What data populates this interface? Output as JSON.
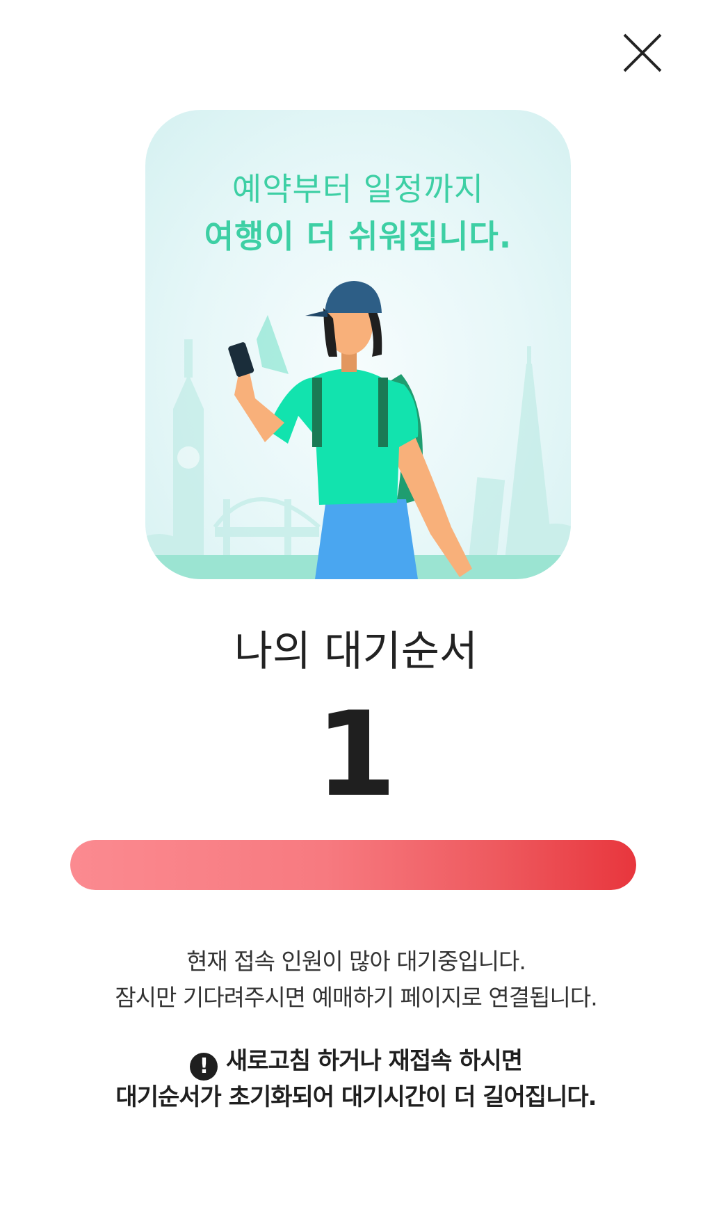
{
  "header": {
    "close_icon": "close-icon"
  },
  "hero": {
    "line1": "예약부터 일정까지",
    "line2": "여행이 더 쉬워집니다.",
    "colors": {
      "headline": "#3dcfa4",
      "shirt": "#12e3ae",
      "pants": "#4aa6f0",
      "cap": "#2d5e86",
      "skin": "#f8b07a"
    }
  },
  "queue": {
    "title": "나의 대기순서",
    "position": "1",
    "progress": 1.0
  },
  "notice": {
    "line1": "현재 접속 인원이 많아 대기중입니다.",
    "line2": "잠시만 기다려주시면 예매하기 페이지로 연결됩니다."
  },
  "warning": {
    "icon": "!",
    "line1": "새로고침 하거나 재접속 하시면",
    "line2": "대기순서가 초기화되어 대기시간이 더 길어집니다."
  },
  "colors": {
    "progress_start": "#fb8a90",
    "progress_end": "#e8363d",
    "text": "#222222"
  }
}
